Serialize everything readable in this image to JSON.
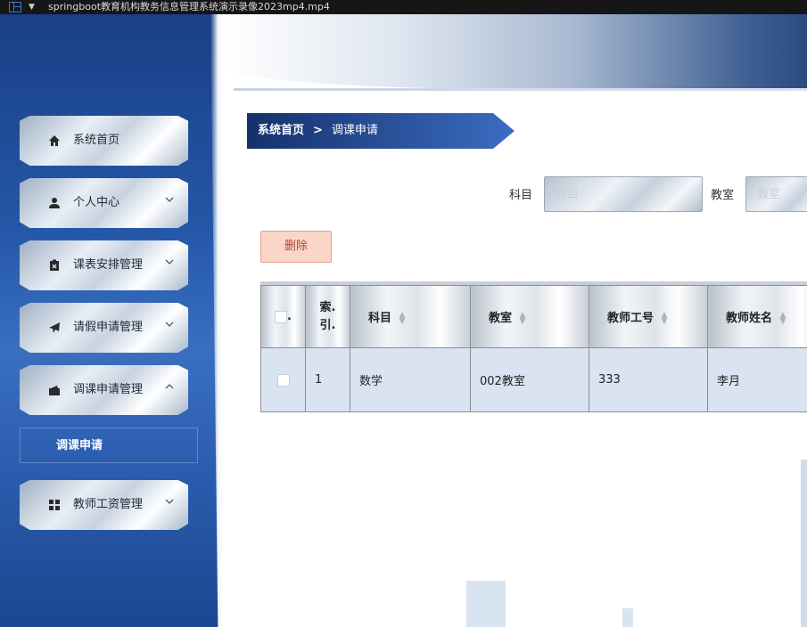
{
  "window": {
    "title": "springboot教育机构教务信息管理系统演示录像2023mp4.mp4"
  },
  "sidebar": {
    "items": [
      {
        "label": "系统首页",
        "icon": "home-icon",
        "expandable": false
      },
      {
        "label": "个人中心",
        "icon": "user-icon",
        "expandable": true,
        "expanded": false
      },
      {
        "label": "课表安排管理",
        "icon": "schedule-icon",
        "expandable": true,
        "expanded": false
      },
      {
        "label": "请假申请管理",
        "icon": "paper-plane-icon",
        "expandable": true,
        "expanded": false
      },
      {
        "label": "调课申请管理",
        "icon": "wallet-icon",
        "expandable": true,
        "expanded": true
      },
      {
        "label": "教师工资管理",
        "icon": "grid-icon",
        "expandable": true,
        "expanded": false
      }
    ],
    "submenu": {
      "label": "调课申请"
    }
  },
  "breadcrumb": {
    "home": "系统首页",
    "separator": ">",
    "current": "调课申请"
  },
  "filters": {
    "subject": {
      "label": "科目",
      "placeholder": "科目",
      "value": ""
    },
    "classroom": {
      "label": "教室",
      "placeholder": "教室",
      "value": ""
    }
  },
  "actions": {
    "delete_label": "删除"
  },
  "table": {
    "headers": {
      "index": "索.\n引.",
      "subject": "科目",
      "classroom": "教室",
      "teacher_id": "教师工号",
      "teacher_name": "教师姓名"
    },
    "rows": [
      {
        "index": "1",
        "subject": "数学",
        "classroom": "002教室",
        "teacher_id": "333",
        "teacher_name": "李月"
      }
    ]
  },
  "colors": {
    "sidebar_blue": "#2457a8",
    "breadcrumb_dark": "#16316b",
    "delete_bg": "#fbd6c8",
    "delete_text": "#b0442a",
    "row_bg": "#d9e3f1"
  }
}
